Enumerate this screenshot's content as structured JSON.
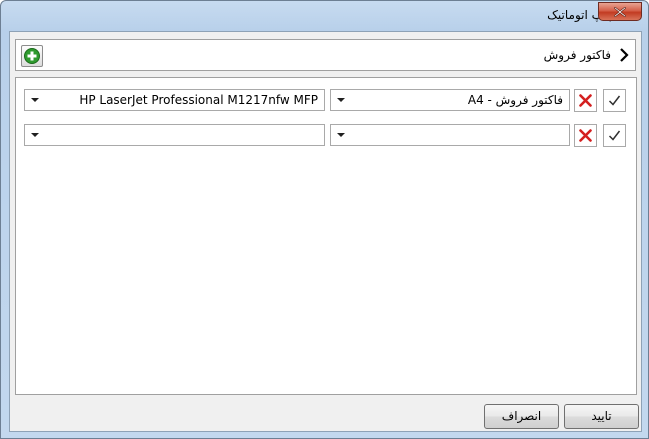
{
  "window": {
    "title": "چاپ اتوماتیک"
  },
  "header": {
    "title": "فاکتور فروش"
  },
  "rows": [
    {
      "form_value": "فاکتور فروش - A4",
      "printer_value": "HP LaserJet Professional M1217nfw MFP"
    },
    {
      "form_value": "",
      "printer_value": ""
    }
  ],
  "footer": {
    "ok_label": "تایید",
    "cancel_label": "انصراف"
  },
  "colors": {
    "accent_green": "#2e9a2e",
    "delete_red": "#d42020",
    "close_red": "#c23b22"
  },
  "icons": {
    "app": "printer-icon",
    "close": "close-icon",
    "add": "plus-circle-icon",
    "chevron": "chevron-right-icon",
    "delete": "red-x-icon",
    "confirm": "checkmark-icon"
  }
}
